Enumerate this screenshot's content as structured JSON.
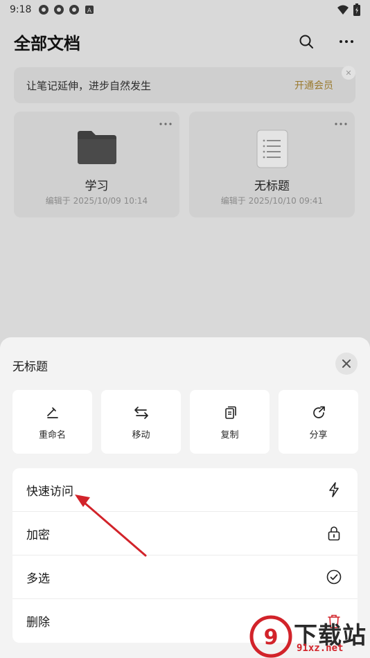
{
  "status_bar": {
    "time": "9:18",
    "notification_icons": [
      "app-icon",
      "app-icon",
      "app-icon",
      "a-icon"
    ],
    "right_icons": [
      "wifi-icon",
      "battery-icon"
    ]
  },
  "header": {
    "title": "全部文档",
    "actions": [
      "search-icon",
      "more-icon"
    ]
  },
  "promo": {
    "text": "让笔记延伸，进步自然发生",
    "link": "开通会员"
  },
  "cards": [
    {
      "type": "folder",
      "icon": "folder-icon",
      "name": "学习",
      "meta": "编辑于 2025/10/09 10:14"
    },
    {
      "type": "document",
      "icon": "document-icon",
      "name": "无标题",
      "meta": "编辑于 2025/10/10 09:41"
    }
  ],
  "sheet": {
    "title": "无标题",
    "actions": [
      {
        "icon": "rename-icon",
        "label": "重命名"
      },
      {
        "icon": "move-icon",
        "label": "移动"
      },
      {
        "icon": "copy-icon",
        "label": "复制"
      },
      {
        "icon": "share-icon",
        "label": "分享"
      }
    ],
    "menu": [
      {
        "icon": "lightning-icon",
        "label": "快速访问"
      },
      {
        "icon": "lock-icon",
        "label": "加密"
      },
      {
        "icon": "check-circle-icon",
        "label": "多选"
      },
      {
        "icon": "trash-icon",
        "label": "删除"
      }
    ]
  },
  "watermark": {
    "text": "下载站",
    "url": "91xz.net"
  },
  "colors": {
    "accent_gold": "#9a7a2e",
    "annotation_red": "#d2232a"
  }
}
